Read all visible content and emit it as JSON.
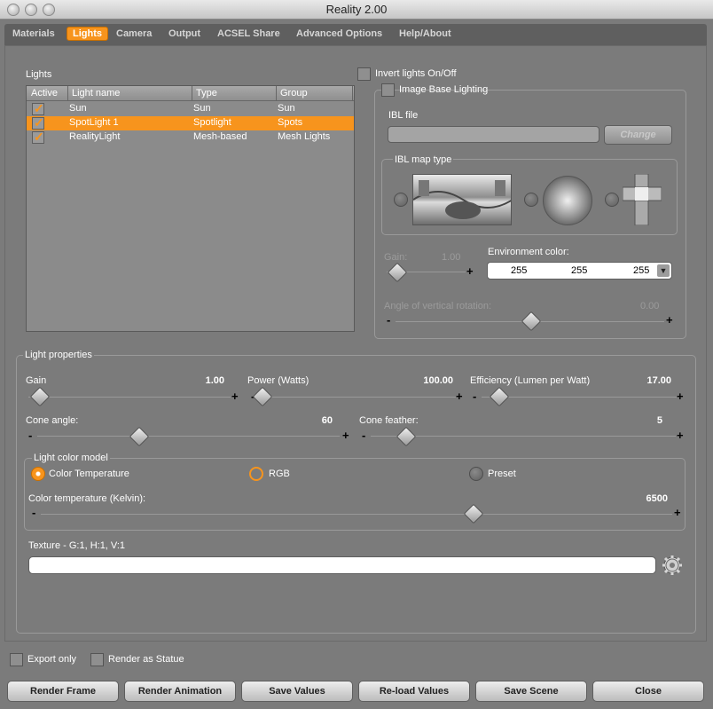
{
  "window": {
    "title": "Reality  2.00"
  },
  "tabs": [
    "Materials",
    "Lights",
    "Camera",
    "Output",
    "ACSEL Share",
    "Advanced Options",
    "Help/About"
  ],
  "lights_panel": {
    "label": "Lights",
    "columns": [
      "Active",
      "Light name",
      "Type",
      "Group"
    ],
    "rows": [
      {
        "active": true,
        "name": "Sun",
        "type": "Sun",
        "group": "Sun",
        "selected": false
      },
      {
        "active": true,
        "name": "SpotLight 1",
        "type": "Spotlight",
        "group": "Spots",
        "selected": true
      },
      {
        "active": true,
        "name": "RealityLight",
        "type": "Mesh-based",
        "group": "Mesh Lights",
        "selected": false
      }
    ]
  },
  "ibl": {
    "invert_label": "Invert lights On/Off",
    "ibl_label": "Image Base Lighting",
    "file_label": "IBL file",
    "file_value": "",
    "change_button": "Change",
    "map_type_label": "IBL map type",
    "gain_label": "Gain:",
    "gain_value": "1.00",
    "env_color_label": "Environment color:",
    "env_color": [
      "255",
      "255",
      "255"
    ],
    "angle_label": "Angle of vertical rotation:",
    "angle_value": "0.00"
  },
  "light_properties": {
    "label": "Light properties",
    "gain_label": "Gain",
    "gain_value": "1.00",
    "power_label": "Power (Watts)",
    "power_value": "100.00",
    "efficiency_label": "Efficiency (Lumen per Watt)",
    "efficiency_value": "17.00",
    "cone_angle_label": "Cone angle:",
    "cone_angle_value": "60",
    "cone_feather_label": "Cone feather:",
    "cone_feather_value": "5",
    "color_model_label": "Light color model",
    "color_models": [
      "Color Temperature",
      "RGB",
      "Preset"
    ],
    "color_temp_label": "Color temperature (Kelvin):",
    "color_temp_value": "6500",
    "texture_label": "Texture - G:1, H:1, V:1",
    "texture_value": ""
  },
  "options": {
    "export_only": "Export only",
    "render_as_statue": "Render as Statue"
  },
  "buttons": [
    "Render Frame",
    "Render Animation",
    "Save Values",
    "Re-load Values",
    "Save Scene",
    "Close"
  ],
  "colors": {
    "accent": "#f7941d",
    "background": "#7b7b7b"
  }
}
